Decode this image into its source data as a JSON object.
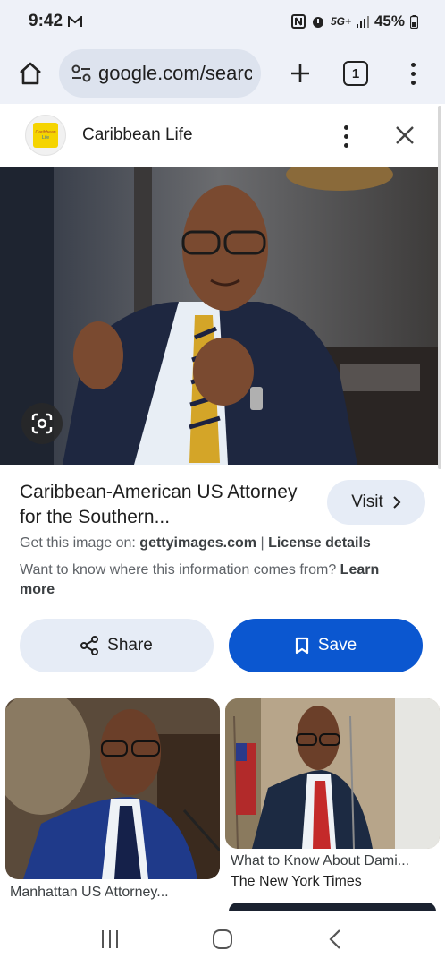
{
  "status_bar": {
    "time": "9:42",
    "network": "5G+",
    "battery": "45%"
  },
  "browser": {
    "url": "google.com/search",
    "tab_count": "1"
  },
  "panel": {
    "site_name": "Caribbean Life",
    "logo_text_top": "Caribbean",
    "logo_text_bottom": "Life"
  },
  "result": {
    "title": "Caribbean-American US Attorney for the Southern...",
    "visit_label": "Visit",
    "source_prefix": "Get this image on:",
    "source_site": "gettyimages.com",
    "separator": "|",
    "license_label": "License details",
    "info_text": "Want to know where this information comes from?",
    "learn_more": "Learn more"
  },
  "actions": {
    "share_label": "Share",
    "save_label": "Save"
  },
  "related": [
    {
      "caption": "Manhattan US Attorney...",
      "source": ""
    },
    {
      "caption": "What to Know About Dami...",
      "source": "The New York Times"
    }
  ],
  "icons": {
    "home": "home-icon",
    "site_settings": "tune-icon",
    "new_tab": "plus-icon",
    "overflow": "more-vert-icon",
    "close": "close-icon",
    "lens": "lens-icon",
    "share": "share-icon",
    "save": "bookmark-icon",
    "visit_arrow": "chevron-right-icon"
  },
  "colors": {
    "save_button": "#0b57d0",
    "tonal_button": "#e6ecf6",
    "browser_bar": "#eef1f8"
  }
}
